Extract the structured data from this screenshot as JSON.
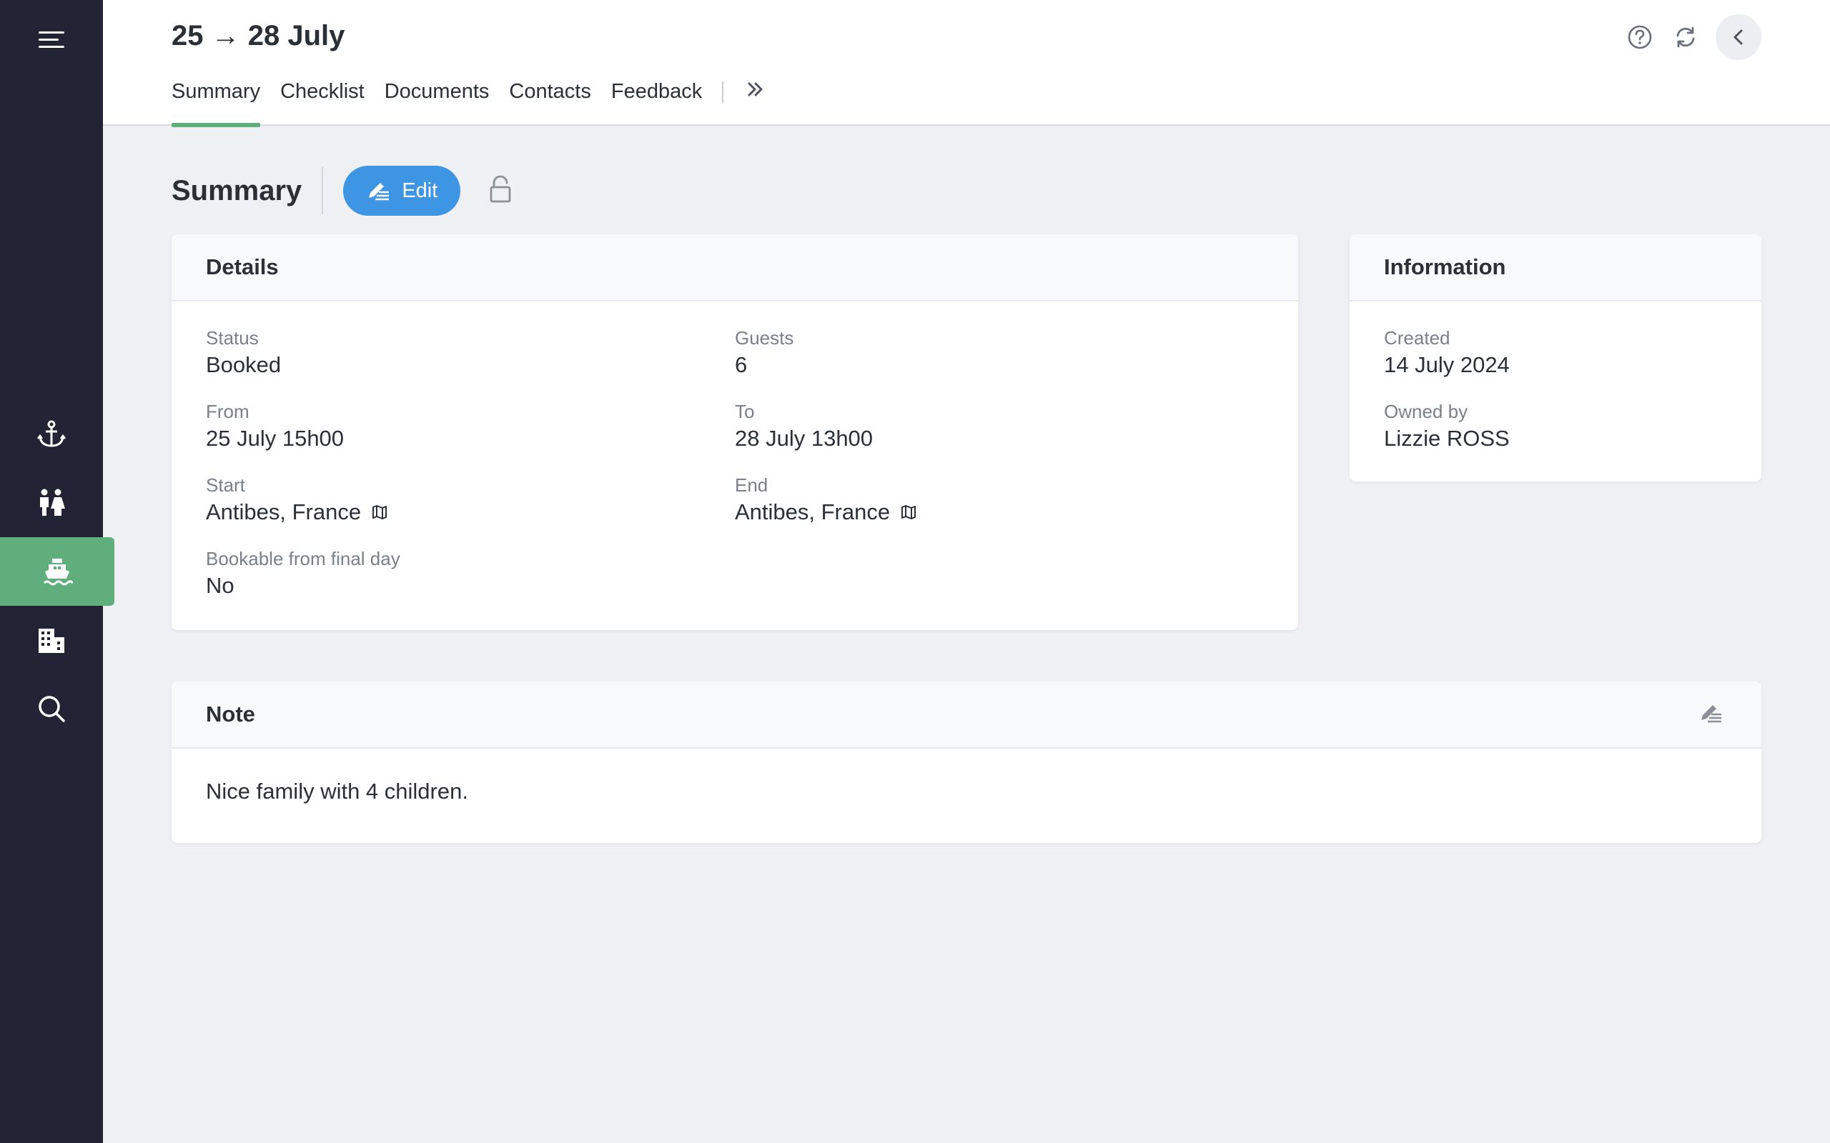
{
  "sidebar": {
    "items": [
      {
        "icon": "anchor-icon",
        "name": "anchor"
      },
      {
        "icon": "people-icon",
        "name": "people"
      },
      {
        "icon": "boat-icon",
        "name": "boat"
      },
      {
        "icon": "building-icon",
        "name": "building"
      },
      {
        "icon": "search-icon",
        "name": "search"
      }
    ],
    "active_color": "#5fae7c",
    "background": "#222436"
  },
  "header": {
    "title": "25 → 28 July",
    "tabs": [
      {
        "label": "Summary"
      },
      {
        "label": "Checklist"
      },
      {
        "label": "Documents"
      },
      {
        "label": "Contacts"
      },
      {
        "label": "Feedback"
      }
    ],
    "active_tab": "Summary"
  },
  "section": {
    "title": "Summary",
    "edit_label": "Edit"
  },
  "details": {
    "title": "Details",
    "status_label": "Status",
    "status_value": "Booked",
    "guests_label": "Guests",
    "guests_value": "6",
    "from_label": "From",
    "from_value": "25 July 15h00",
    "to_label": "To",
    "to_value": "28 July 13h00",
    "start_label": "Start",
    "start_value": "Antibes, France",
    "end_label": "End",
    "end_value": "Antibes, France",
    "bookable_label": "Bookable from final day",
    "bookable_value": "No"
  },
  "information": {
    "title": "Information",
    "created_label": "Created",
    "created_value": "14 July 2024",
    "owner_label": "Owned by",
    "owner_value": "Lizzie ROSS"
  },
  "note": {
    "title": "Note",
    "text": "Nice family with 4 children."
  },
  "colors": {
    "accent": "#5fae7c",
    "primary_button": "#3d95e3",
    "page_background": "#eff0f4"
  }
}
